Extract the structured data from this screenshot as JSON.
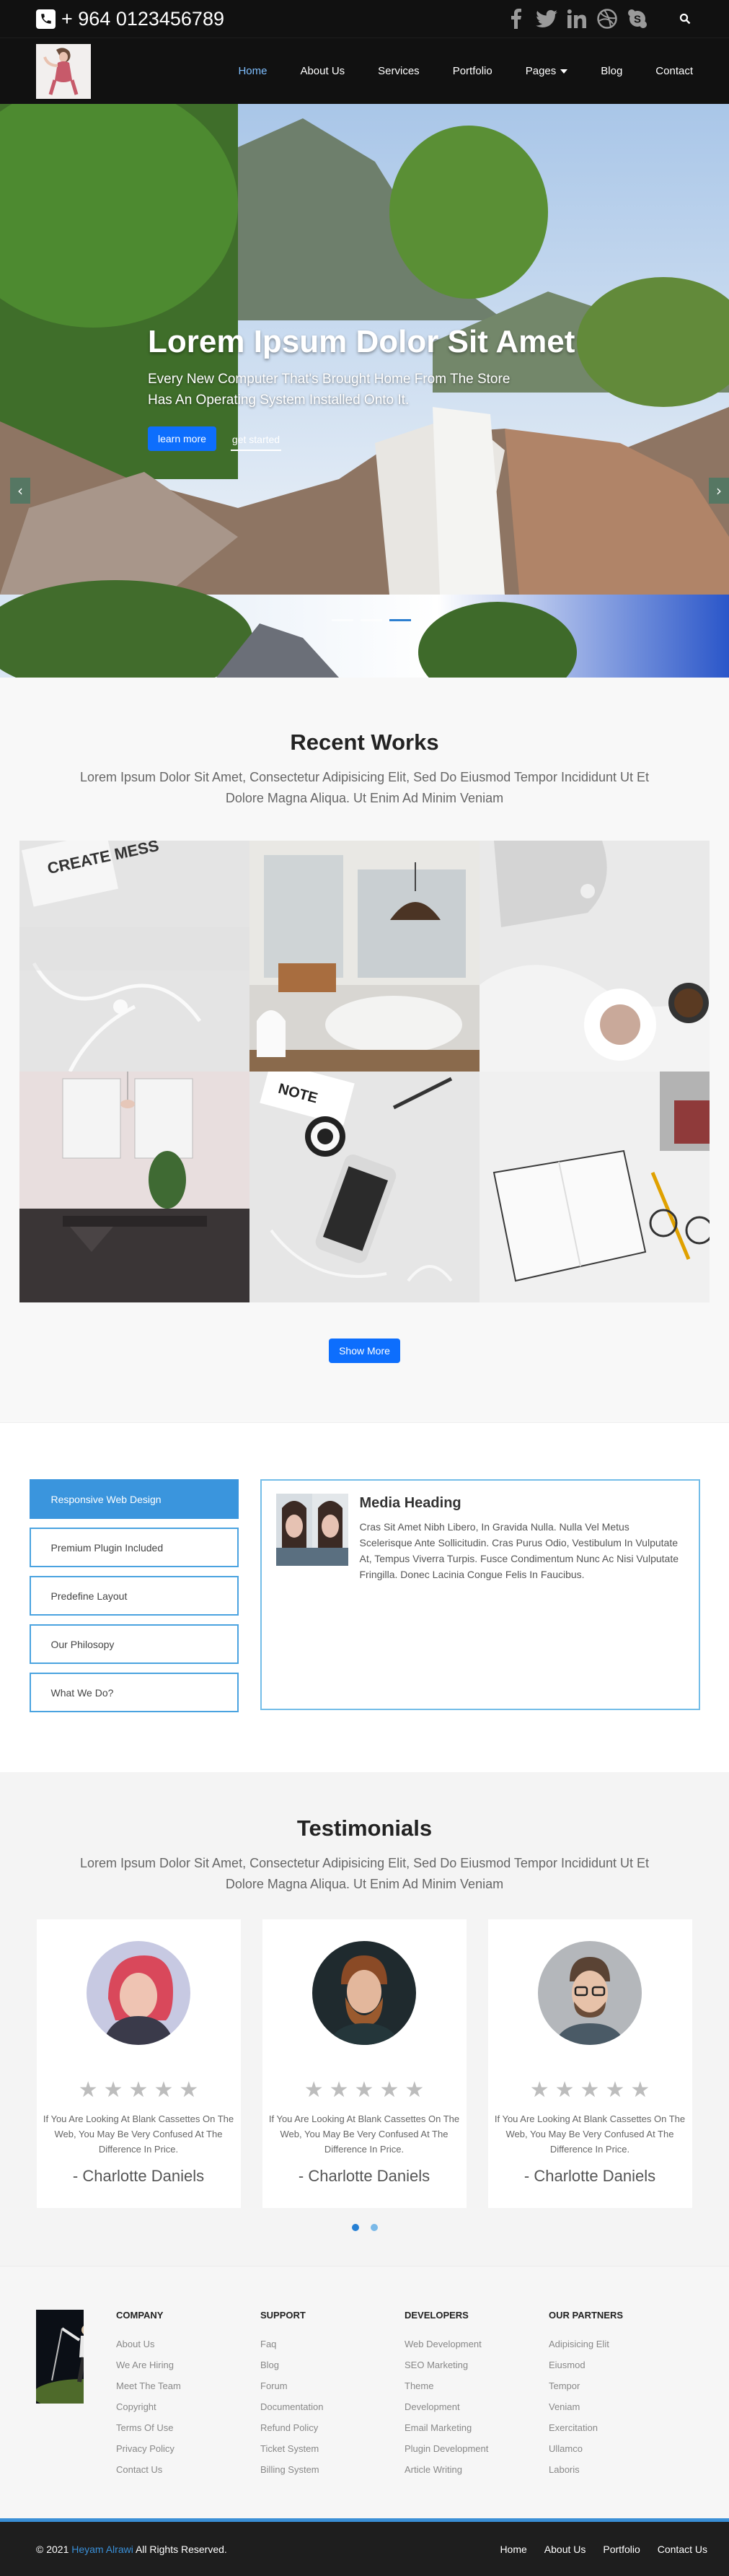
{
  "topbar": {
    "phone": "+ 964 0123456789",
    "social_icons": [
      "facebook-icon",
      "twitter-icon",
      "linkedin-icon",
      "dribbble-icon",
      "skype-icon"
    ]
  },
  "nav": {
    "items": [
      {
        "label": "Home",
        "active": true
      },
      {
        "label": "About Us"
      },
      {
        "label": "Services"
      },
      {
        "label": "Portfolio"
      },
      {
        "label": "Pages",
        "dropdown": true
      },
      {
        "label": "Blog"
      },
      {
        "label": "Contact"
      }
    ]
  },
  "hero": {
    "title": "Lorem Ipsum Dolor Sit Amet",
    "text": "Every New Computer That's Brought Home From The Store Has An Operating System Installed Onto It.",
    "primary_button": "learn more",
    "secondary_button": "get started",
    "slides": 3,
    "active_slide": 3
  },
  "works": {
    "title": "Recent Works",
    "subtitle": "Lorem Ipsum Dolor Sit Amet, Consectetur Adipisicing Elit, Sed Do Eiusmod Tempor Incididunt Ut Et Dolore Magna Aliqua. Ut Enim Ad Minim Veniam",
    "button": "Show More"
  },
  "tabs": {
    "items": [
      "Responsive Web Design",
      "Premium Plugin Included",
      "Predefine Layout",
      "Our Philosopy",
      "What We Do?"
    ],
    "active": 0,
    "media_heading": "Media Heading",
    "media_text": "Cras Sit Amet Nibh Libero, In Gravida Nulla. Nulla Vel Metus Scelerisque Ante Sollicitudin. Cras Purus Odio, Vestibulum In Vulputate At, Tempus Viverra Turpis. Fusce Condimentum Nunc Ac Nisi Vulputate Fringilla. Donec Lacinia Congue Felis In Faucibus."
  },
  "testimonials": {
    "title": "Testimonials",
    "subtitle": "Lorem Ipsum Dolor Sit Amet, Consectetur Adipisicing Elit, Sed Do Eiusmod Tempor Incididunt Ut Et Dolore Magna Aliqua. Ut Enim Ad Minim Veniam",
    "cards": [
      {
        "text": "If You Are Looking At Blank Cassettes On The Web, You May Be Very Confused At The Difference In Price.",
        "name": "- Charlotte Daniels",
        "rating": 5
      },
      {
        "text": "If You Are Looking At Blank Cassettes On The Web, You May Be Very Confused At The Difference In Price.",
        "name": "- Charlotte Daniels",
        "rating": 5
      },
      {
        "text": "If You Are Looking At Blank Cassettes On The Web, You May Be Very Confused At The Difference In Price.",
        "name": "- Charlotte Daniels",
        "rating": 5
      }
    ]
  },
  "footer": {
    "columns": [
      {
        "heading": "COMPANY",
        "links": [
          "About Us",
          "We Are Hiring",
          "Meet The Team",
          "Copyright",
          "Terms Of Use",
          "Privacy Policy",
          "Contact Us"
        ]
      },
      {
        "heading": "SUPPORT",
        "links": [
          "Faq",
          "Blog",
          "Forum",
          "Documentation",
          "Refund Policy",
          "Ticket System",
          "Billing System"
        ]
      },
      {
        "heading": "DEVELOPERS",
        "links": [
          "Web Development",
          "SEO Marketing",
          "Theme",
          "Development",
          "Email Marketing",
          "Plugin Development",
          "Article Writing"
        ]
      },
      {
        "heading": "OUR PARTNERS",
        "links": [
          "Adipisicing Elit",
          "Eiusmod",
          "Tempor",
          "Veniam",
          "Exercitation",
          "Ullamco",
          "Laboris"
        ]
      }
    ]
  },
  "bottom": {
    "copyright_prefix": "© 2021",
    "copyright_name": "Heyam Alrawi",
    "copyright_suffix": "All Rights Reserved.",
    "links": [
      "Home",
      "About Us",
      "Portfolio",
      "Contact Us"
    ]
  },
  "colors": {
    "accent": "#3a95dd",
    "button": "#0d6efd",
    "dark": "#111111"
  }
}
